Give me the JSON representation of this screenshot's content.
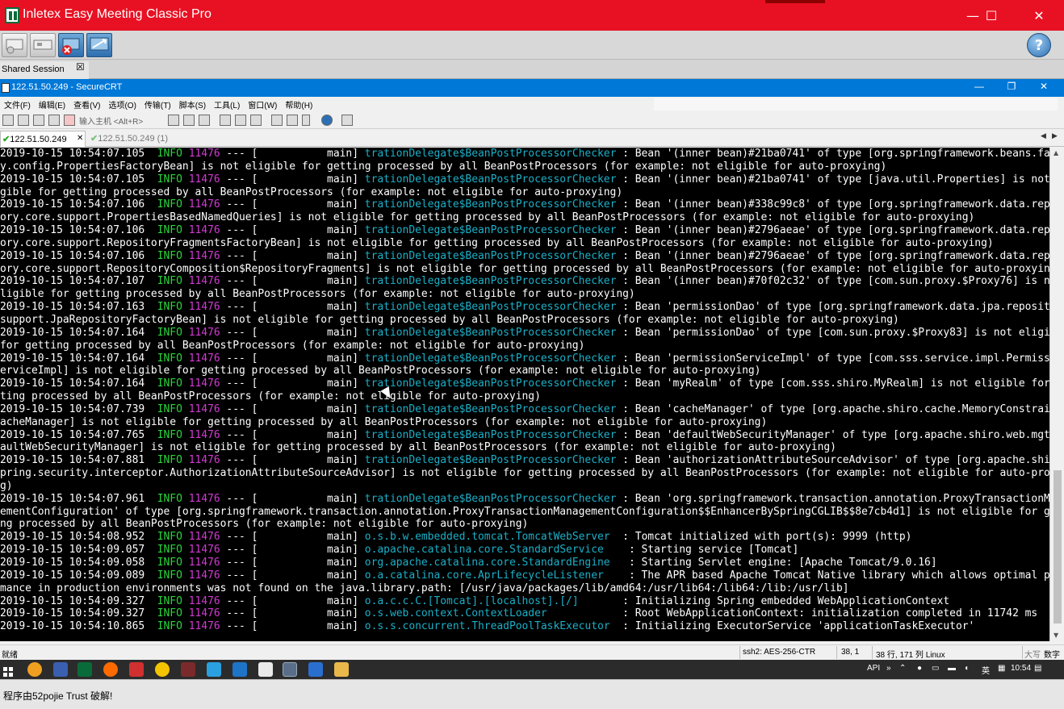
{
  "app": {
    "title": "Inletex Easy Meeting Classic Pro",
    "minimize_glyph": "—",
    "maximize_glyph": "☐",
    "close_glyph": "✕"
  },
  "shared_session": {
    "label": "Shared Session",
    "close_glyph": "☒"
  },
  "crt": {
    "title": "122.51.50.249 - SecureCRT",
    "minimize_glyph": "—",
    "restore_glyph": "❐",
    "close_glyph": "✕",
    "menu": [
      "文件(F)",
      "编辑(E)",
      "查看(V)",
      "选项(O)",
      "传输(T)",
      "脚本(S)",
      "工具(L)",
      "窗口(W)",
      "帮助(H)"
    ],
    "quick_connect_placeholder": "输入主机 <Alt+R>",
    "tabs": [
      {
        "label": "122.51.50.249",
        "active": true,
        "close_glyph": "✕"
      },
      {
        "label": "122.51.50.249 (1)",
        "active": false
      }
    ],
    "nav_left": "◀",
    "nav_right": "▶"
  },
  "terminal_lines": [
    {
      "ts": "2019-10-15 10:54:07.105",
      "lvl": "INFO",
      "pid": "11476",
      "mid": " --- [           main] ",
      "logger": "trationDelegate$BeanPostProcessorChecker",
      "msg": " : Bean '(inner bean)#21ba0741' of type [org.springframework.beans.factor"
    },
    {
      "text": "y.config.PropertiesFactoryBean] is not eligible for getting processed by all BeanPostProcessors (for example: not eligible for auto-proxying)"
    },
    {
      "ts": "2019-10-15 10:54:07.105",
      "lvl": "INFO",
      "pid": "11476",
      "mid": " --- [           main] ",
      "logger": "trationDelegate$BeanPostProcessorChecker",
      "msg": " : Bean '(inner bean)#21ba0741' of type [java.util.Properties] is not eli"
    },
    {
      "text": "gible for getting processed by all BeanPostProcessors (for example: not eligible for auto-proxying)"
    },
    {
      "ts": "2019-10-15 10:54:07.106",
      "lvl": "INFO",
      "pid": "11476",
      "mid": " --- [           main] ",
      "logger": "trationDelegate$BeanPostProcessorChecker",
      "msg": " : Bean '(inner bean)#338c99c8' of type [org.springframework.data.reposit"
    },
    {
      "text": "ory.core.support.PropertiesBasedNamedQueries] is not eligible for getting processed by all BeanPostProcessors (for example: not eligible for auto-proxying)"
    },
    {
      "ts": "2019-10-15 10:54:07.106",
      "lvl": "INFO",
      "pid": "11476",
      "mid": " --- [           main] ",
      "logger": "trationDelegate$BeanPostProcessorChecker",
      "msg": " : Bean '(inner bean)#2796aeae' of type [org.springframework.data.reposit"
    },
    {
      "text": "ory.core.support.RepositoryFragmentsFactoryBean] is not eligible for getting processed by all BeanPostProcessors (for example: not eligible for auto-proxying)"
    },
    {
      "ts": "2019-10-15 10:54:07.106",
      "lvl": "INFO",
      "pid": "11476",
      "mid": " --- [           main] ",
      "logger": "trationDelegate$BeanPostProcessorChecker",
      "msg": " : Bean '(inner bean)#2796aeae' of type [org.springframework.data.reposit"
    },
    {
      "text": "ory.core.support.RepositoryComposition$RepositoryFragments] is not eligible for getting processed by all BeanPostProcessors (for example: not eligible for auto-proxying)"
    },
    {
      "ts": "2019-10-15 10:54:07.107",
      "lvl": "INFO",
      "pid": "11476",
      "mid": " --- [           main] ",
      "logger": "trationDelegate$BeanPostProcessorChecker",
      "msg": " : Bean '(inner bean)#70f02c32' of type [com.sun.proxy.$Proxy76] is not e"
    },
    {
      "text": "ligible for getting processed by all BeanPostProcessors (for example: not eligible for auto-proxying)"
    },
    {
      "ts": "2019-10-15 10:54:07.163",
      "lvl": "INFO",
      "pid": "11476",
      "mid": " --- [           main] ",
      "logger": "trationDelegate$BeanPostProcessorChecker",
      "msg": " : Bean 'permissionDao' of type [org.springframework.data.jpa.repository."
    },
    {
      "text": "support.JpaRepositoryFactoryBean] is not eligible for getting processed by all BeanPostProcessors (for example: not eligible for auto-proxying)"
    },
    {
      "ts": "2019-10-15 10:54:07.164",
      "lvl": "INFO",
      "pid": "11476",
      "mid": " --- [           main] ",
      "logger": "trationDelegate$BeanPostProcessorChecker",
      "msg": " : Bean 'permissionDao' of type [com.sun.proxy.$Proxy83] is not eligible"
    },
    {
      "text": "for getting processed by all BeanPostProcessors (for example: not eligible for auto-proxying)"
    },
    {
      "ts": "2019-10-15 10:54:07.164",
      "lvl": "INFO",
      "pid": "11476",
      "mid": " --- [           main] ",
      "logger": "trationDelegate$BeanPostProcessorChecker",
      "msg": " : Bean 'permissionServiceImpl' of type [com.sss.service.impl.PermissionS"
    },
    {
      "text": "erviceImpl] is not eligible for getting processed by all BeanPostProcessors (for example: not eligible for auto-proxying)"
    },
    {
      "ts": "2019-10-15 10:54:07.164",
      "lvl": "INFO",
      "pid": "11476",
      "mid": " --- [           main] ",
      "logger": "trationDelegate$BeanPostProcessorChecker",
      "msg": " : Bean 'myRealm' of type [com.sss.shiro.MyRealm] is not eligible for get"
    },
    {
      "text": "ting processed by all BeanPostProcessors (for example: not eligible for auto-proxying)"
    },
    {
      "ts": "2019-10-15 10:54:07.739",
      "lvl": "INFO",
      "pid": "11476",
      "mid": " --- [           main] ",
      "logger": "trationDelegate$BeanPostProcessorChecker",
      "msg": " : Bean 'cacheManager' of type [org.apache.shiro.cache.MemoryConstrainedC"
    },
    {
      "text": "acheManager] is not eligible for getting processed by all BeanPostProcessors (for example: not eligible for auto-proxying)"
    },
    {
      "ts": "2019-10-15 10:54:07.765",
      "lvl": "INFO",
      "pid": "11476",
      "mid": " --- [           main] ",
      "logger": "trationDelegate$BeanPostProcessorChecker",
      "msg": " : Bean 'defaultWebSecurityManager' of type [org.apache.shiro.web.mgt.Def"
    },
    {
      "text": "aultWebSecurityManager] is not eligible for getting processed by all BeanPostProcessors (for example: not eligible for auto-proxying)"
    },
    {
      "ts": "2019-10-15 10:54:07.881",
      "lvl": "INFO",
      "pid": "11476",
      "mid": " --- [           main] ",
      "logger": "trationDelegate$BeanPostProcessorChecker",
      "msg": " : Bean 'authorizationAttributeSourceAdvisor' of type [org.apache.shiro.s"
    },
    {
      "text": "pring.security.interceptor.AuthorizationAttributeSourceAdvisor] is not eligible for getting processed by all BeanPostProcessors (for example: not eligible for auto-proxyin"
    },
    {
      "text": "g)"
    },
    {
      "ts": "2019-10-15 10:54:07.961",
      "lvl": "INFO",
      "pid": "11476",
      "mid": " --- [           main] ",
      "logger": "trationDelegate$BeanPostProcessorChecker",
      "msg": " : Bean 'org.springframework.transaction.annotation.ProxyTransactionManag"
    },
    {
      "text": "ementConfiguration' of type [org.springframework.transaction.annotation.ProxyTransactionManagementConfiguration$$EnhancerBySpringCGLIB$$8e7cb4d1] is not eligible for getti"
    },
    {
      "text": "ng processed by all BeanPostProcessors (for example: not eligible for auto-proxying)"
    },
    {
      "ts": "2019-10-15 10:54:08.952",
      "lvl": "INFO",
      "pid": "11476",
      "mid": " --- [           main] ",
      "logger": "o.s.b.w.embedded.tomcat.TomcatWebServer ",
      "msg": " : Tomcat initialized with port(s): 9999 (http)"
    },
    {
      "ts": "2019-10-15 10:54:09.057",
      "lvl": "INFO",
      "pid": "11476",
      "mid": " --- [           main] ",
      "logger": "o.apache.catalina.core.StandardService   ",
      "msg": " : Starting service [Tomcat]"
    },
    {
      "ts": "2019-10-15 10:54:09.058",
      "lvl": "INFO",
      "pid": "11476",
      "mid": " --- [           main] ",
      "logger": "org.apache.catalina.core.StandardEngine  ",
      "msg": " : Starting Servlet engine: [Apache Tomcat/9.0.16]"
    },
    {
      "ts": "2019-10-15 10:54:09.089",
      "lvl": "INFO",
      "pid": "11476",
      "mid": " --- [           main] ",
      "logger": "o.a.catalina.core.AprLifecycleListener   ",
      "msg": " : The APR based Apache Tomcat Native library which allows optimal perfor"
    },
    {
      "text": "mance in production environments was not found on the java.library.path: [/usr/java/packages/lib/amd64:/usr/lib64:/lib64:/lib:/usr/lib]"
    },
    {
      "ts": "2019-10-15 10:54:09.327",
      "lvl": "INFO",
      "pid": "11476",
      "mid": " --- [           main] ",
      "logger": "o.a.c.c.C.[Tomcat].[localhost].[/]      ",
      "msg": " : Initializing Spring embedded WebApplicationContext"
    },
    {
      "ts": "2019-10-15 10:54:09.327",
      "lvl": "INFO",
      "pid": "11476",
      "mid": " --- [           main] ",
      "logger": "o.s.web.context.ContextLoader           ",
      "msg": " : Root WebApplicationContext: initialization completed in 11742 ms"
    },
    {
      "ts": "2019-10-15 10:54:10.865",
      "lvl": "INFO",
      "pid": "11476",
      "mid": " --- [           main] ",
      "logger": "o.s.s.concurrent.ThreadPoolTaskExecutor ",
      "msg": " : Initializing ExecutorService 'applicationTaskExecutor'"
    }
  ],
  "status": {
    "ready": "就绪",
    "cipher": "ssh2: AES-256-CTR",
    "cursor_pos": "38,  1",
    "dims": "38 行, 171 列 Linux",
    "caps": "大写",
    "num": "数字"
  },
  "taskbar": {
    "api": "API",
    "ime": "英",
    "time": "10:54"
  },
  "notice": "程序由52pojie Trust 破解!",
  "colors": {
    "outer_title": "#e81123",
    "crt_title": "#0078d7",
    "info": "#29d33a",
    "pid": "#d33ad3",
    "logger": "#1bb0c8"
  }
}
